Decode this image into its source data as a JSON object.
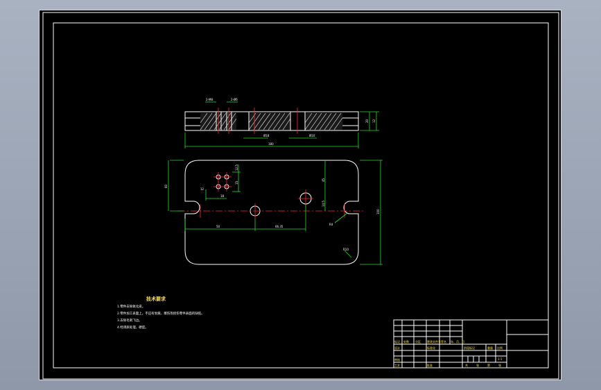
{
  "drawing": {
    "section_view": {
      "dim_top_left": "2-M8",
      "dim_top_right": "2-Ø6",
      "dim_hole_1": "Ø18",
      "dim_hole_2": "Ø10",
      "dim_overall_length": "180",
      "dim_height_1": "20",
      "dim_height_2": "12"
    },
    "plan_view": {
      "dim_pattern_h": "12.5",
      "dim_pattern_v": "15",
      "dim_pattern_w": "12",
      "dim_pattern_offset": "18",
      "dim_left_height": "60",
      "dim_right_top": "45",
      "dim_right_mid": "14.5",
      "dim_center_x": "50",
      "dim_hole_spacing": "66.35",
      "dim_slot": "R4",
      "dim_corner_radius": "R10",
      "dim_overall_height": "100"
    },
    "tech_requirements": {
      "title": "技术要求",
      "lines": [
        "1.零件去除氧化皮。",
        "2.零件加工表面上，不应有划痕、擦伤等损伤零件表面的缺陷。",
        "3.去除毛刺飞边。",
        "4.经调质处理，硬度。"
      ]
    },
    "title_block": {
      "row1": [
        "标记",
        "处数",
        "分区",
        "更改文件号",
        "签名",
        "年、月、日"
      ],
      "row2": [
        "设计",
        "标准化"
      ],
      "row3": [
        "审核"
      ],
      "row4": [
        "工艺",
        "批准"
      ],
      "material_cells": [
        "阶段标记",
        "重量",
        "比例"
      ],
      "scale": "1:1",
      "sheet_cells": [
        "共",
        "张",
        "第",
        "张"
      ]
    }
  }
}
